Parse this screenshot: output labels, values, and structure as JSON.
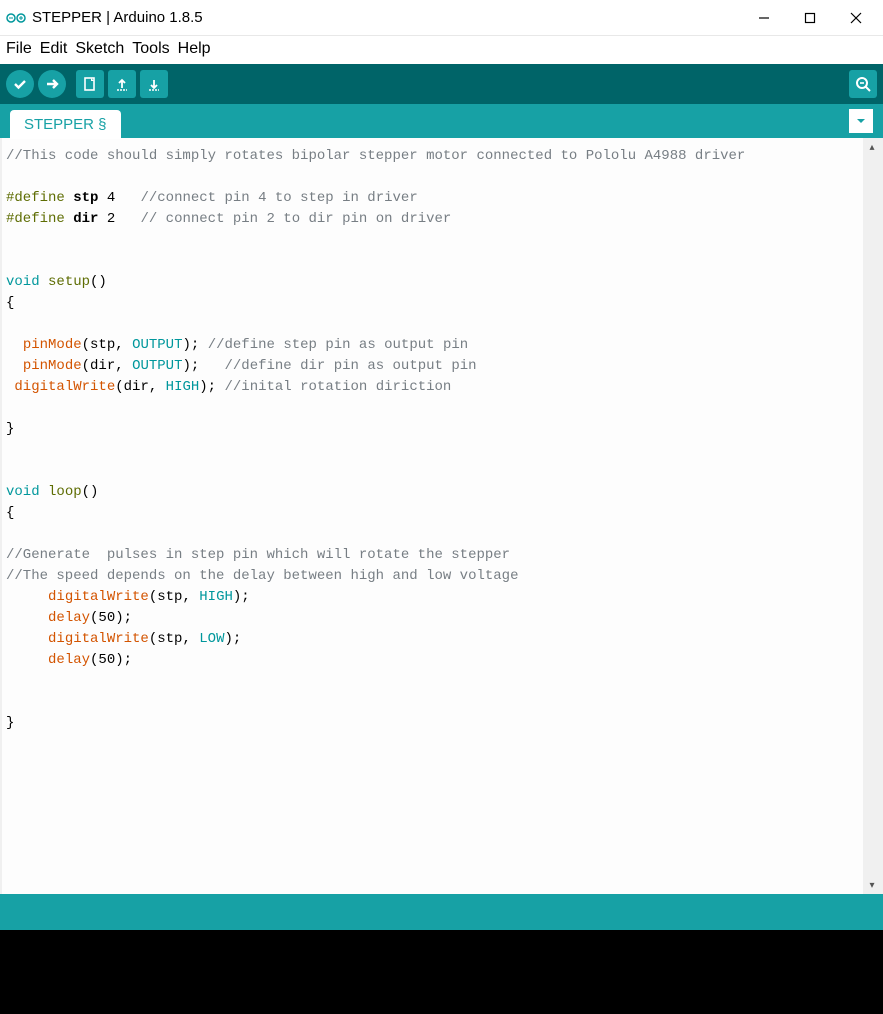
{
  "window": {
    "title": "STEPPER | Arduino 1.8.5"
  },
  "menu": {
    "file": "File",
    "edit": "Edit",
    "sketch": "Sketch",
    "tools": "Tools",
    "help": "Help"
  },
  "tab": {
    "label": "STEPPER §"
  },
  "code": {
    "l1_comment": "//This code should simply rotates bipolar stepper motor connected to Pololu A4988 driver",
    "l3_define": "#define",
    "l3_name": "stp",
    "l3_val": "4",
    "l3_comment": "//connect pin 4 to step in driver",
    "l4_define": "#define",
    "l4_name": "dir",
    "l4_val": "2",
    "l4_comment": "// connect pin 2 to dir pin on driver",
    "l7_type": "void",
    "l7_name": "setup",
    "l7_paren": "()",
    "l8_brace": "{",
    "l10_fn": "pinMode",
    "l10_open": "(",
    "l10_arg1": "stp",
    "l10_comma": ", ",
    "l10_arg2": "OUTPUT",
    "l10_close": "); ",
    "l10_comment": "//define step pin as output pin",
    "l11_fn": "pinMode",
    "l11_open": "(",
    "l11_arg1": "dir",
    "l11_comma": ", ",
    "l11_arg2": "OUTPUT",
    "l11_close": ");   ",
    "l11_comment": "//define dir pin as output pin",
    "l12_fn": "digitalWrite",
    "l12_open": "(",
    "l12_arg1": "dir",
    "l12_comma": ", ",
    "l12_arg2": "HIGH",
    "l12_close": "); ",
    "l12_comment": "//inital rotation diriction",
    "l14_brace": "}",
    "l17_type": "void",
    "l17_name": "loop",
    "l17_paren": "()",
    "l18_brace": "{",
    "l20_comment": "//Generate  pulses in step pin which will rotate the stepper",
    "l21_comment": "//The speed depends on the delay between high and low voltage",
    "l22_fn": "digitalWrite",
    "l22_open": "(",
    "l22_arg1": "stp",
    "l22_comma": ", ",
    "l22_arg2": "HIGH",
    "l22_close": ");",
    "l23_fn": "delay",
    "l23_args": "(50);",
    "l24_fn": "digitalWrite",
    "l24_open": "(",
    "l24_arg1": "stp",
    "l24_comma": ", ",
    "l24_arg2": "LOW",
    "l24_close": ");",
    "l25_fn": "delay",
    "l25_args": "(50);",
    "l28_brace": "}"
  }
}
